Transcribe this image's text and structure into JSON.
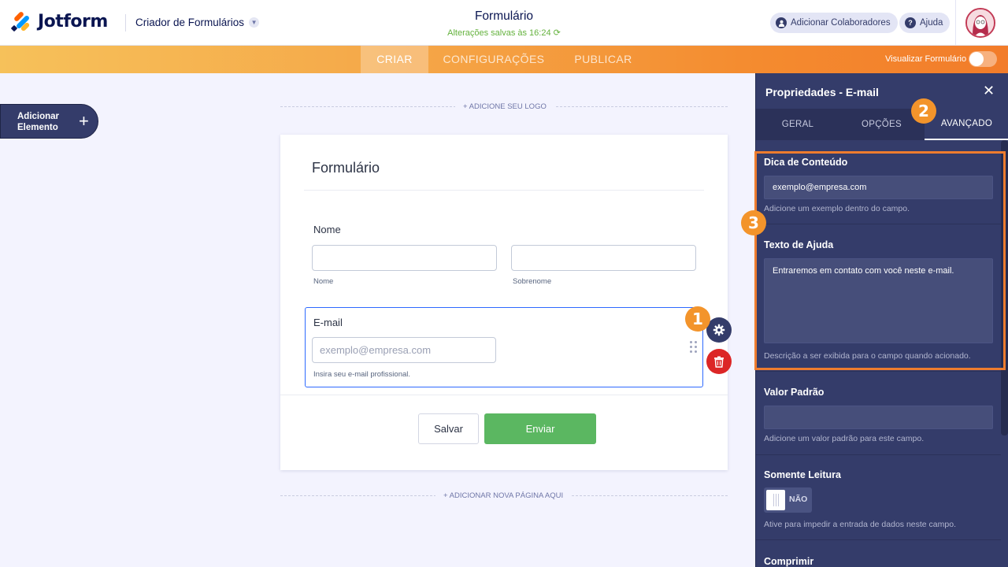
{
  "header": {
    "brand": "Jotform",
    "builder_menu": "Criador de Formulários",
    "form_title": "Formulário",
    "saved_status": "Alterações salvas às 16:24",
    "add_collaborators": "Adicionar Colaboradores",
    "help": "Ajuda"
  },
  "nav": {
    "tabs": [
      {
        "label": "CRIAR",
        "active": true
      },
      {
        "label": "CONFIGURAÇÕES",
        "active": false
      },
      {
        "label": "PUBLICAR",
        "active": false
      }
    ],
    "preview_label": "Visualizar Formulário",
    "preview_on": false
  },
  "canvas": {
    "add_element": "Adicionar Elemento",
    "add_logo": "+ ADICIONE SEU LOGO",
    "add_page": "+ ADICIONAR NOVA PÁGINA AQUI"
  },
  "form": {
    "heading": "Formulário",
    "name_label": "Nome",
    "first_sublabel": "Nome",
    "last_sublabel": "Sobrenome",
    "email_label": "E-mail",
    "email_placeholder": "exemplo@empresa.com",
    "email_sublabel": "Insira seu e-mail profissional.",
    "save_button": "Salvar",
    "submit_button": "Enviar"
  },
  "badges": {
    "one": "1",
    "two": "2",
    "three": "3"
  },
  "panel": {
    "title": "Propriedades - E-mail",
    "close": "✕",
    "tabs": [
      {
        "label": "GERAL",
        "active": false
      },
      {
        "label": "OPÇÕES",
        "active": false
      },
      {
        "label": "AVANÇADO",
        "active": true
      }
    ],
    "hint": {
      "title": "Dica de Conteúdo",
      "value": "exemplo@empresa.com",
      "help": "Adicione um exemplo dentro do campo."
    },
    "help_text": {
      "title": "Texto de Ajuda",
      "value": "Entraremos em contato com você neste e-mail.",
      "help": "Descrição a ser exibida para o campo quando acionado."
    },
    "default_value": {
      "title": "Valor Padrão",
      "value": "",
      "help": "Adicione um valor padrão para este campo."
    },
    "read_only": {
      "title": "Somente Leitura",
      "state": "NÃO",
      "help": "Ative para impedir a entrada de dados neste campo."
    },
    "shrink": {
      "title": "Comprimir"
    }
  },
  "colors": {
    "accent_orange": "#f3942b",
    "panel_bg": "#343c6a",
    "submit_green": "#5bb761",
    "delete_red": "#dc2626",
    "selected_blue": "#2e69ff"
  }
}
